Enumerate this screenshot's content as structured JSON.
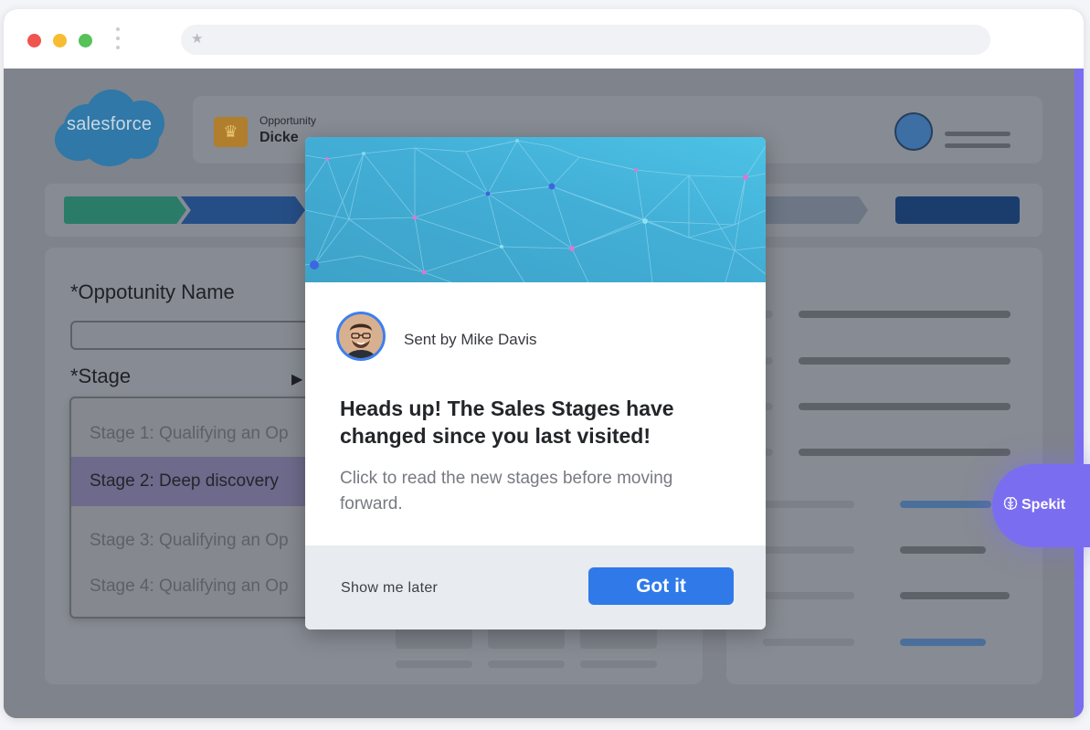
{
  "browser": {
    "url": ""
  },
  "salesforce": {
    "logo_text": "salesforce",
    "record_type": "Opportunity",
    "record_name": "Dicke",
    "form": {
      "name_label": "*Oppotunity Name",
      "stage_label": "*Stage",
      "stage_options": [
        "Stage 1: Qualifying an Op",
        "Stage 2: Deep discovery",
        "Stage 3: Qualifying an Op",
        "Stage 4: Qualifying an Op"
      ],
      "selected_index": 1
    }
  },
  "spekit": {
    "label": "Spekit",
    "accent": "#7b6df0"
  },
  "modal": {
    "sender": "Sent by Mike Davis",
    "title": "Heads up! The Sales Stages have changed since you last visited!",
    "body": "Click to read the new stages before moving forward.",
    "later_label": "Show me later",
    "confirm_label": "Got it",
    "confirm_color": "#2f7ae8"
  }
}
